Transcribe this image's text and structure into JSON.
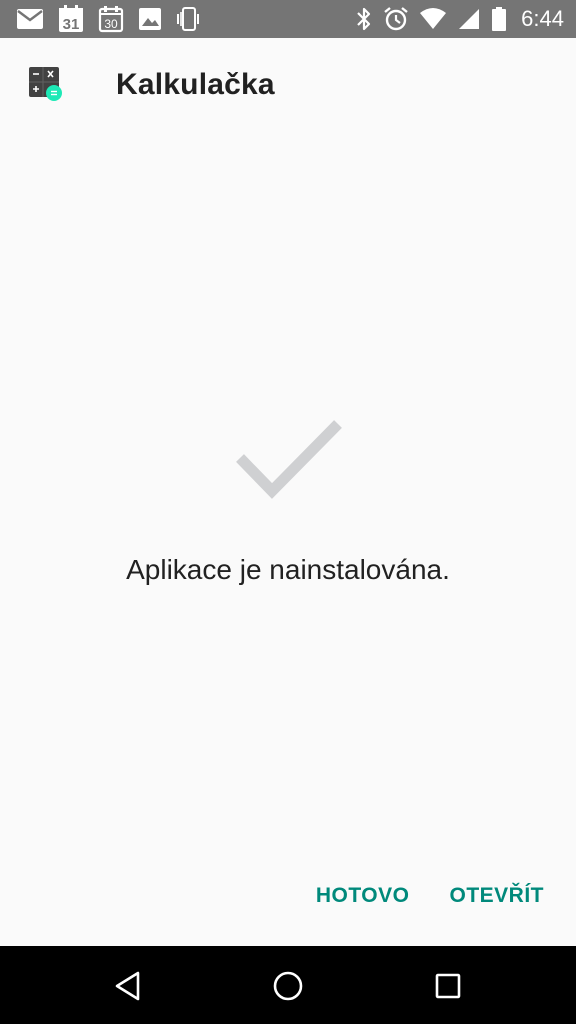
{
  "status_bar": {
    "time": "6:44",
    "calendar_day": "31",
    "calendar_day_2": "30",
    "left_icons": [
      "mail-icon",
      "calendar-icon",
      "calendar-icon",
      "image-icon",
      "phone-vibrate-icon"
    ],
    "right_icons": [
      "bluetooth-icon",
      "alarm-icon",
      "wifi-icon",
      "cellular-signal-icon",
      "battery-icon"
    ]
  },
  "app": {
    "title": "Kalkulačka",
    "icon": "calculator-icon"
  },
  "main": {
    "status_icon": "checkmark-icon",
    "message": "Aplikace je nainstalována."
  },
  "actions": {
    "done_label": "HOTOVO",
    "open_label": "OTEVŘÍT"
  },
  "nav_bar": {
    "icons": [
      "back-icon",
      "home-icon",
      "recents-icon"
    ]
  },
  "colors": {
    "accent": "#00897b",
    "status_bar": "#757575",
    "nav_bar": "#000000",
    "background": "#fafafa",
    "checkmark": "#cfd0d2"
  }
}
